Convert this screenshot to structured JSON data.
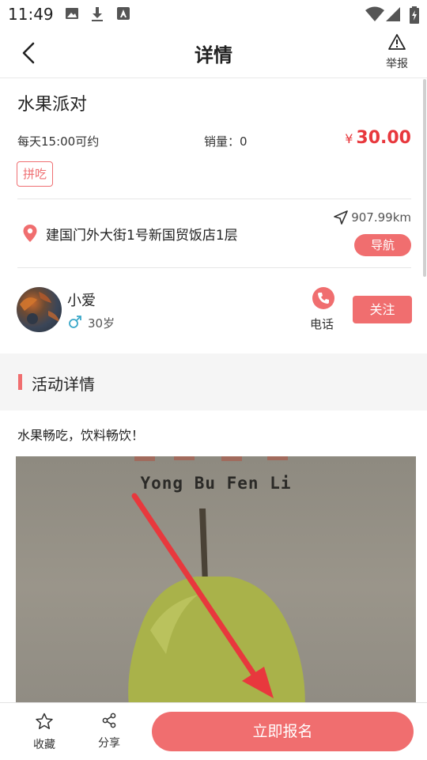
{
  "status_bar": {
    "time": "11:49"
  },
  "header": {
    "title": "详情",
    "report_label": "举报"
  },
  "event": {
    "name": "水果派对",
    "time_text": "每天15:00可约",
    "sales_text": "销量：0",
    "price_symbol": "¥",
    "price": "30.00",
    "tag": "拼吃"
  },
  "location": {
    "address": "建国门外大街1号新国贸饭店1层",
    "distance": "907.99km",
    "nav_label": "导航"
  },
  "host": {
    "name": "小爱",
    "age": "30岁",
    "phone_label": "电话",
    "follow_label": "关注"
  },
  "section": {
    "title": "活动详情"
  },
  "description": "水果畅吃，饮料畅饮！",
  "photo": {
    "caption": "Yong Bu Fen Li"
  },
  "bottom_bar": {
    "favorite_label": "收藏",
    "share_label": "分享",
    "signup_label": "立即报名"
  },
  "colors": {
    "accent": "#f06e6f",
    "price": "#e8383d",
    "arrow": "#e8383d"
  },
  "icons": {
    "back": "chevron-left-icon",
    "report": "warning-icon",
    "location": "map-pin-icon",
    "distance": "navigation-arrow-icon",
    "gender": "male-icon",
    "phone": "phone-icon",
    "favorite": "star-icon",
    "share": "share-icon"
  }
}
